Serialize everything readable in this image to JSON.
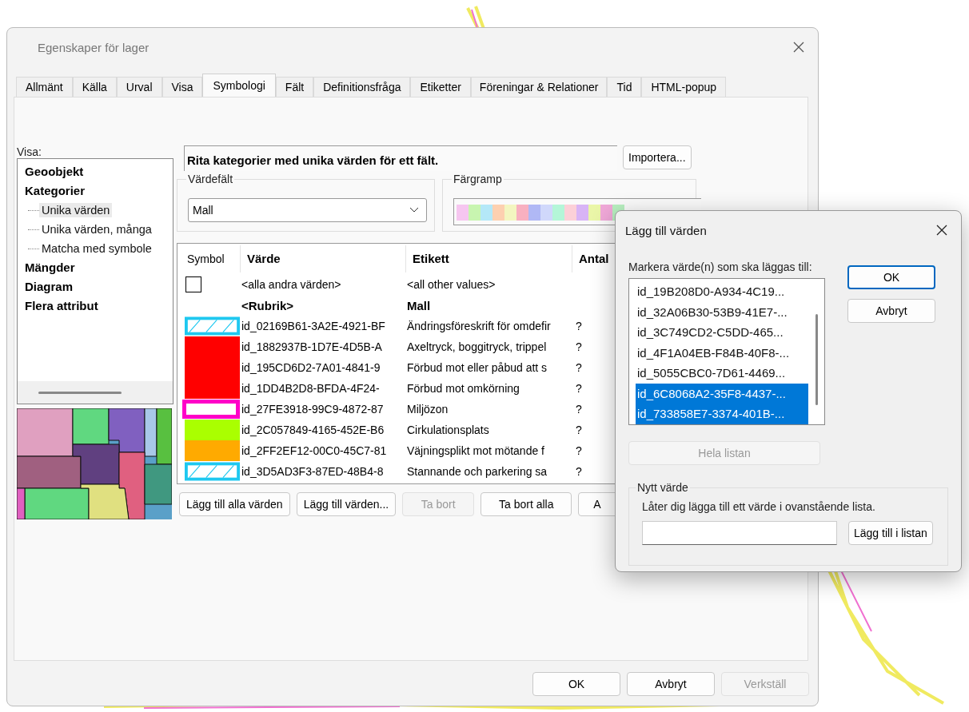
{
  "window": {
    "title": "Egenskaper för lager"
  },
  "tabs": [
    {
      "label": "Allmänt",
      "selected": false
    },
    {
      "label": "Källa",
      "selected": false
    },
    {
      "label": "Urval",
      "selected": false
    },
    {
      "label": "Visa",
      "selected": false
    },
    {
      "label": "Symbologi",
      "selected": true
    },
    {
      "label": "Fält",
      "selected": false
    },
    {
      "label": "Definitionsfråga",
      "selected": false
    },
    {
      "label": "Etiketter",
      "selected": false
    },
    {
      "label": "Föreningar & Relationer",
      "selected": false
    },
    {
      "label": "Tid",
      "selected": false
    },
    {
      "label": "HTML-popup",
      "selected": false
    }
  ],
  "show_label": "Visa:",
  "tree": [
    {
      "label": "Geoobjekt",
      "selected": false
    },
    {
      "label": "Kategorier",
      "selected": false,
      "children": [
        {
          "label": "Unika värden",
          "selected": true
        },
        {
          "label": "Unika värden, många",
          "selected": false
        },
        {
          "label": "Matcha med symbole",
          "selected": false
        }
      ]
    },
    {
      "label": "Mängder",
      "selected": false
    },
    {
      "label": "Diagram",
      "selected": false
    },
    {
      "label": "Flera attribut",
      "selected": false
    }
  ],
  "description": "Rita kategorier med unika värden för ett fält.",
  "import_button": "Importera...",
  "value_field": {
    "legend": "Värdefält",
    "value": "Mall"
  },
  "color_ramp": {
    "legend": "Färgramp"
  },
  "table": {
    "columns": [
      "Symbol",
      "Värde",
      "Etikett",
      "Antal"
    ],
    "rows": [
      {
        "kind": "other",
        "symbol": {
          "kind": "empty"
        },
        "value": "<alla andra värden>",
        "label": "<all other values>"
      },
      {
        "kind": "heading",
        "symbol": {
          "kind": "none"
        },
        "value": "<Rubrik>",
        "label": "Mall"
      },
      {
        "kind": "value",
        "symbol": {
          "kind": "hatch",
          "color": "#1ec8f0"
        },
        "value": "id_02169B61-3A2E-4921-BF",
        "label": "Ändringsföreskrift för omdefir",
        "count": "?"
      },
      {
        "kind": "value",
        "symbol": {
          "kind": "fill",
          "color": "#ff0000"
        },
        "value": "id_1882937B-1D7E-4D5B-A",
        "label": "Axeltryck, boggitryck, trippel",
        "count": "?"
      },
      {
        "kind": "value",
        "symbol": {
          "kind": "fill",
          "color": "#ff0000"
        },
        "value": "id_195CD6D2-7A01-4841-9",
        "label": "Förbud mot eller påbud att s",
        "count": "?"
      },
      {
        "kind": "value",
        "symbol": {
          "kind": "fill",
          "color": "#ff0000"
        },
        "value": "id_1DD4B2D8-BFDA-4F24-",
        "label": "Förbud mot omkörning",
        "count": "?"
      },
      {
        "kind": "value",
        "symbol": {
          "kind": "outline",
          "color": "#ff00c8"
        },
        "value": "id_27FE3918-99C9-4872-87",
        "label": "Miljözon",
        "count": "?"
      },
      {
        "kind": "value",
        "symbol": {
          "kind": "fill",
          "color": "#aaff00"
        },
        "value": "id_2C057849-4165-452E-B6",
        "label": "Cirkulationsplats",
        "count": "?"
      },
      {
        "kind": "value",
        "symbol": {
          "kind": "fill",
          "color": "#ffaa00"
        },
        "value": "id_2FF2EF12-00C0-45C7-81",
        "label": "Väjningsplikt mot mötande f",
        "count": "?"
      },
      {
        "kind": "value",
        "symbol": {
          "kind": "hatch",
          "color": "#1ec8f0"
        },
        "value": "id_3D5AD3F3-87ED-48B4-8",
        "label": "Stannande och parkering sa",
        "count": "?"
      }
    ]
  },
  "table_buttons": [
    {
      "label": "Lägg till alla värden",
      "disabled": false
    },
    {
      "label": "Lägg till värden...",
      "disabled": false
    },
    {
      "label": "Ta bort",
      "disabled": true
    },
    {
      "label": "Ta bort alla",
      "disabled": false
    },
    {
      "label": "A",
      "disabled": false
    }
  ],
  "footer_buttons": [
    {
      "label": "OK",
      "disabled": false
    },
    {
      "label": "Avbryt",
      "disabled": false
    },
    {
      "label": "Verkställ",
      "disabled": true
    }
  ],
  "add_dialog": {
    "title": "Lägg till värden",
    "prompt": "Markera värde(n) som ska läggas till:",
    "items": [
      {
        "label": "id_19B208D0-A934-4C19...",
        "selected": false
      },
      {
        "label": "id_32A06B30-53B9-41E7-...",
        "selected": false
      },
      {
        "label": "id_3C749CD2-C5DD-465...",
        "selected": false
      },
      {
        "label": "id_4F1A04EB-F84B-40F8-...",
        "selected": false
      },
      {
        "label": "id_5055CBC0-7D61-4469...",
        "selected": false
      },
      {
        "label": "id_6C8068A2-35F8-4437-...",
        "selected": true
      },
      {
        "label": "id_733858E7-3374-401B-...",
        "selected": true
      }
    ],
    "ok": "OK",
    "cancel": "Avbryt",
    "whole_list": {
      "label": "Hela listan",
      "disabled": true
    },
    "new_value": {
      "legend": "Nytt värde",
      "hint": "Låter dig lägga till ett värde i ovanstående lista.",
      "add_button": "Lägg till i listan"
    }
  }
}
